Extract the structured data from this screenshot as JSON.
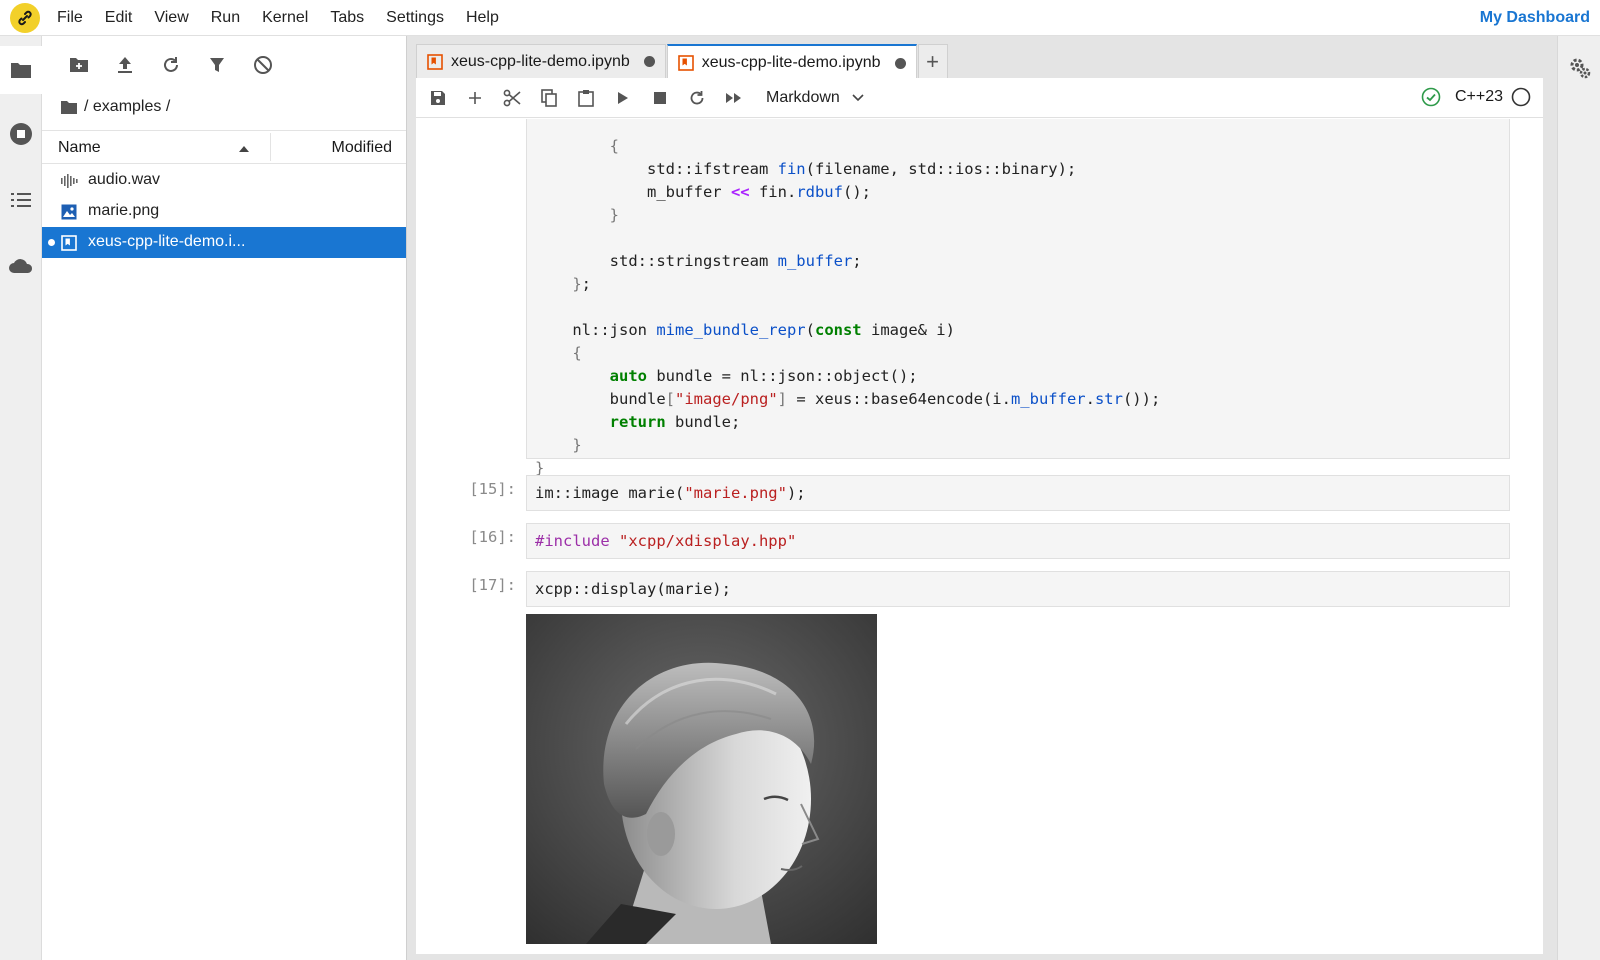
{
  "menubar": {
    "items": [
      "File",
      "Edit",
      "View",
      "Run",
      "Kernel",
      "Tabs",
      "Settings",
      "Help"
    ],
    "dashboard_link": "My Dashboard"
  },
  "activity_bar": {
    "icons": [
      "folder-icon",
      "running-icon",
      "toc-icon",
      "cloud-icon"
    ]
  },
  "file_browser": {
    "toolbar_icons": [
      "new-folder-icon",
      "upload-icon",
      "refresh-icon",
      "filter-icon",
      "clear-icon"
    ],
    "breadcrumb": "/ examples /",
    "columns": {
      "name": "Name",
      "modified": "Modified"
    },
    "files": [
      {
        "name": "audio.wav",
        "icon": "audio-file-icon",
        "selected": false
      },
      {
        "name": "marie.png",
        "icon": "image-file-icon",
        "selected": false
      },
      {
        "name": "xeus-cpp-lite-demo.i...",
        "icon": "notebook-file-icon",
        "selected": true
      }
    ]
  },
  "tabs": [
    {
      "label": "xeus-cpp-lite-demo.ipynb",
      "active": false
    },
    {
      "label": "xeus-cpp-lite-demo.ipynb",
      "active": true
    }
  ],
  "notebook_toolbar": {
    "cell_type": "Markdown",
    "kernel_name": "C++23",
    "icons": [
      "save-icon",
      "add-cell-icon",
      "cut-icon",
      "copy-icon",
      "paste-icon",
      "run-icon",
      "stop-icon",
      "restart-icon",
      "run-all-icon"
    ]
  },
  "cells": [
    {
      "prompt": "[15]:",
      "code": "im::image marie(\"marie.png\");"
    },
    {
      "prompt": "[16]:",
      "code": "#include \"xcpp/xdisplay.hpp\""
    },
    {
      "prompt": "[17]:",
      "code": "xcpp::display(marie);"
    }
  ],
  "top_cell_code": [
    "        {",
    "            std::ifstream fin(filename, std::ios::binary);",
    "            m_buffer << fin.rdbuf();",
    "        }",
    "",
    "        std::stringstream m_buffer;",
    "    };",
    "",
    "    nl::json mime_bundle_repr(const image& i)",
    "    {",
    "        auto bundle = nl::json::object();",
    "        bundle[\"image/png\"] = xeus::base64encode(i.m_buffer.str());",
    "        return bundle;",
    "    }",
    "}"
  ],
  "colors": {
    "accent": "#1976d2",
    "logo": "#f2d02a",
    "kernel_ok": "#2e9a4a"
  }
}
